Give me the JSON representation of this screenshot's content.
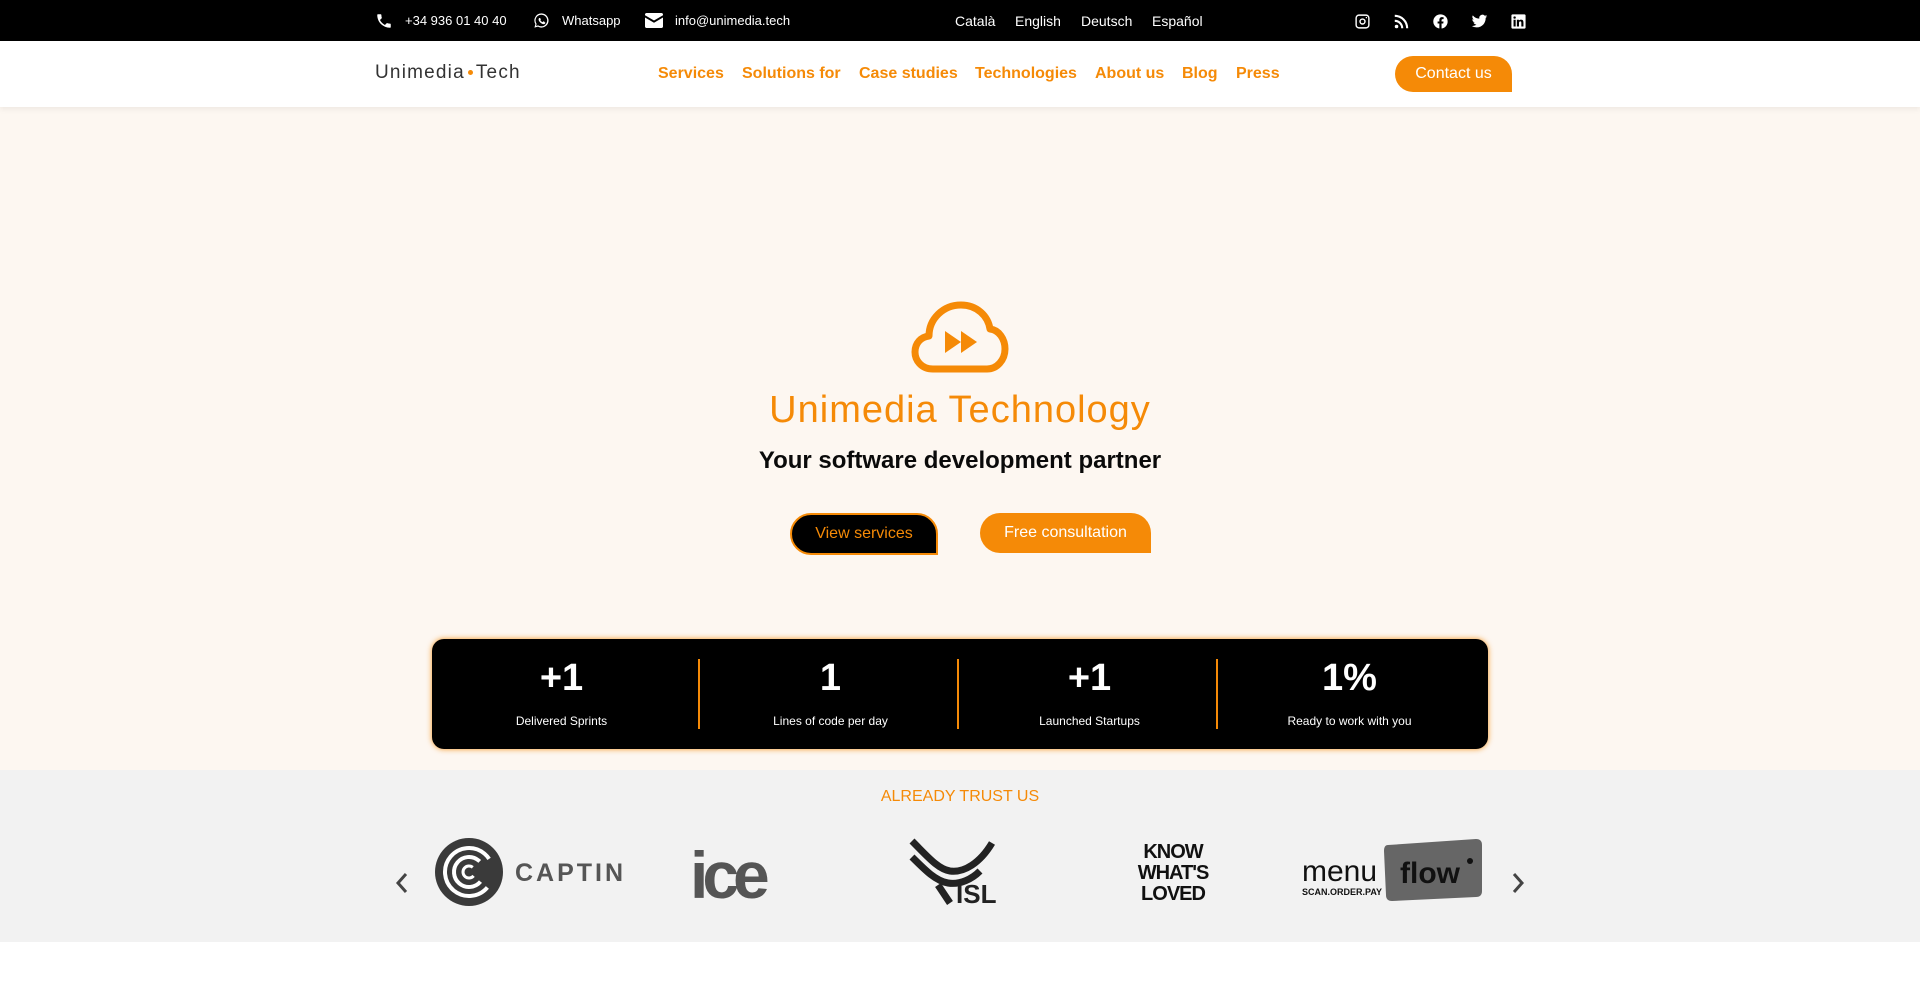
{
  "topbar": {
    "phone": "+34 936 01 40 40",
    "whatsapp": "Whatsapp",
    "email": "info@unimedia.tech",
    "languages": [
      "Català",
      "English",
      "Deutsch",
      "Español"
    ]
  },
  "header": {
    "logo_left": "Unimedia",
    "logo_right": "Tech",
    "nav": [
      "Services",
      "Solutions for",
      "Case studies",
      "Technologies",
      "About us",
      "Blog",
      "Press"
    ],
    "contact_label": "Contact us"
  },
  "hero": {
    "title": "Unimedia Technology",
    "subtitle": "Your software development partner",
    "view_services": "View services",
    "free_consultation": "Free consultation"
  },
  "stats": [
    {
      "value": "+1",
      "label": "Delivered Sprints"
    },
    {
      "value": "1",
      "label": "Lines of code per day"
    },
    {
      "value": "+1",
      "label": "Launched Startups"
    },
    {
      "value": "1%",
      "label": "Ready to work with you"
    }
  ],
  "trust": {
    "title": "ALREADY TRUST US",
    "logos": {
      "captini": "CAPTINI",
      "ice": "ice",
      "isl": "ISL",
      "kwl": [
        "KNOW",
        "WHAT'S",
        "LOVED"
      ],
      "menuflow": {
        "menu": "menu",
        "tagline": "SCAN.ORDER.PAY",
        "flow": "flow"
      }
    }
  },
  "colors": {
    "accent": "#f58a07",
    "dark": "#000000",
    "hero_bg": "#fdf7f1",
    "trust_bg": "#f2f2f2"
  }
}
